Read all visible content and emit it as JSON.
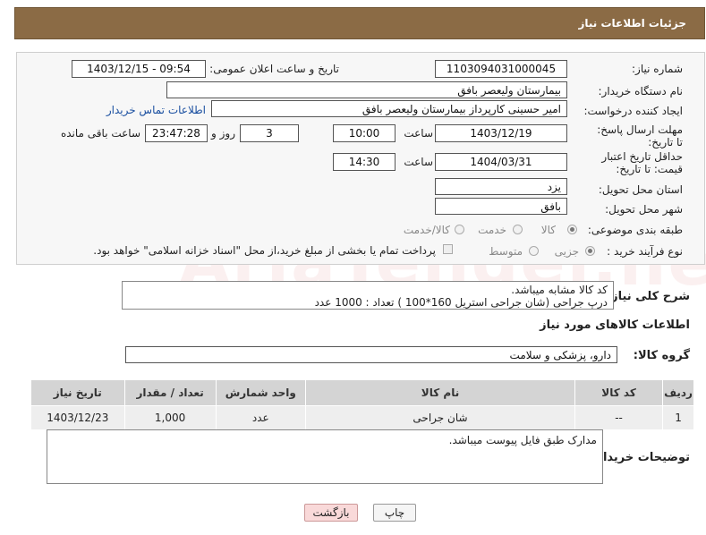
{
  "header": {
    "title": "جزئیات اطلاعات نیاز"
  },
  "form": {
    "need_number_label": "شماره نیاز:",
    "need_number": "1103094031000045",
    "announce_label": "تاریخ و ساعت اعلان عمومی:",
    "announce_value": "1403/12/15 - 09:54",
    "buyer_org_label": "نام دستگاه خریدار:",
    "buyer_org": "بیمارستان ولیعصر بافق",
    "creator_label": "ایجاد کننده درخواست:",
    "creator": "امیر حسینی کارپرداز بیمارستان ولیعصر بافق",
    "contact_link": "اطلاعات تماس خریدار",
    "reply_deadline_label": "مهلت ارسال پاسخ: تا تاریخ:",
    "reply_date": "1403/12/19",
    "time_label": "ساعت",
    "reply_time": "10:00",
    "days_value": "3",
    "days_label": "روز و",
    "remaining_time": "23:47:28",
    "remaining_label": "ساعت باقی مانده",
    "price_validity_label": "حداقل تاریخ اعتبار قیمت: تا تاریخ:",
    "validity_date": "1404/03/31",
    "validity_time": "14:30",
    "province_label": "استان محل تحویل:",
    "province": "یزد",
    "city_label": "شهر محل تحویل:",
    "city": "بافق",
    "category_label": "طبقه بندی موضوعی:",
    "category_options": [
      "کالا",
      "خدمت",
      "کالا/خدمت"
    ],
    "process_label": "نوع فرآیند خرید :",
    "process_options": [
      "جزیی",
      "متوسط"
    ],
    "payment_note": "پرداخت تمام یا بخشی از مبلغ خرید،از محل \"اسناد خزانه اسلامی\" خواهد بود."
  },
  "description": {
    "label": "شرح کلی نیاز:",
    "line1": "کد کالا مشابه میباشد.",
    "line2": "درپ جراحی (شان جراحی استریل 160*100 ) تعداد : 1000 عدد"
  },
  "goods": {
    "section_title": "اطلاعات کالاهای مورد نیاز",
    "group_label": "گروه کالا:",
    "group_value": "دارو، پزشکی و سلامت",
    "columns": [
      "ردیف",
      "کد کالا",
      "نام کالا",
      "واحد شمارش",
      "تعداد / مقدار",
      "تاریخ نیاز"
    ],
    "rows": [
      {
        "index": "1",
        "code": "--",
        "name": "شان جراحی",
        "unit": "عدد",
        "qty": "1,000",
        "date": "1403/12/23"
      }
    ]
  },
  "buyer_notes": {
    "label": "توضیحات خریدار:",
    "text": "مدارک طبق فایل پیوست میباشد."
  },
  "buttons": {
    "print": "چاپ",
    "back": "بازگشت"
  },
  "colors": {
    "header_bg": "#8b6b45",
    "link": "#1a4fa0",
    "back_button_bg": "#f9d9d9"
  }
}
